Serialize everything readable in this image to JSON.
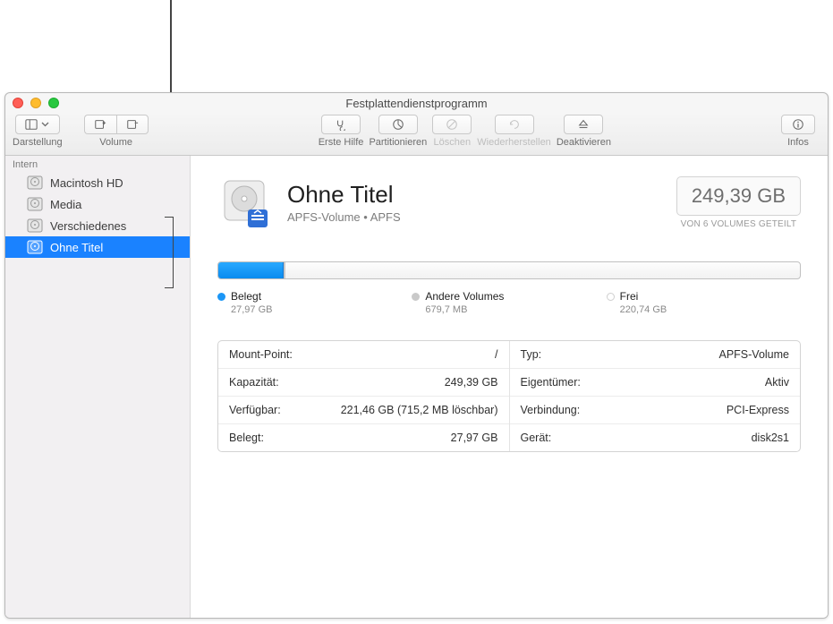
{
  "window": {
    "title": "Festplattendienstprogramm"
  },
  "toolbar": {
    "view_label": "Darstellung",
    "volume_label": "Volume",
    "first_aid": "Erste Hilfe",
    "partition": "Partitionieren",
    "erase": "Löschen",
    "restore": "Wiederherstellen",
    "unmount": "Deaktivieren",
    "info": "Infos"
  },
  "sidebar": {
    "section": "Intern",
    "items": [
      {
        "label": "Macintosh HD",
        "selected": false
      },
      {
        "label": "Media",
        "selected": false
      },
      {
        "label": "Verschiedenes",
        "selected": false
      },
      {
        "label": "Ohne Titel",
        "selected": true
      }
    ]
  },
  "main": {
    "title": "Ohne Titel",
    "subtitle": "APFS-Volume • APFS",
    "capacity": "249,39 GB",
    "capacity_sub": "VON 6 VOLUMES GETEILT",
    "usage": {
      "used_pct": 11.2,
      "other_pct": 0.3,
      "legend": [
        {
          "label": "Belegt",
          "value": "27,97 GB",
          "color": "#1b96f6"
        },
        {
          "label": "Andere Volumes",
          "value": "679,7 MB",
          "color": "#c9c9c9"
        },
        {
          "label": "Frei",
          "value": "220,74 GB",
          "color": "#ffffff"
        }
      ]
    },
    "info_left": [
      {
        "k": "Mount-Point:",
        "v": "/"
      },
      {
        "k": "Kapazität:",
        "v": "249,39 GB"
      },
      {
        "k": "Verfügbar:",
        "v": "221,46 GB (715,2 MB löschbar)"
      },
      {
        "k": "Belegt:",
        "v": "27,97 GB"
      }
    ],
    "info_right": [
      {
        "k": "Typ:",
        "v": "APFS-Volume"
      },
      {
        "k": "Eigentümer:",
        "v": "Aktiv"
      },
      {
        "k": "Verbindung:",
        "v": "PCI-Express"
      },
      {
        "k": "Gerät:",
        "v": "disk2s1"
      }
    ]
  }
}
